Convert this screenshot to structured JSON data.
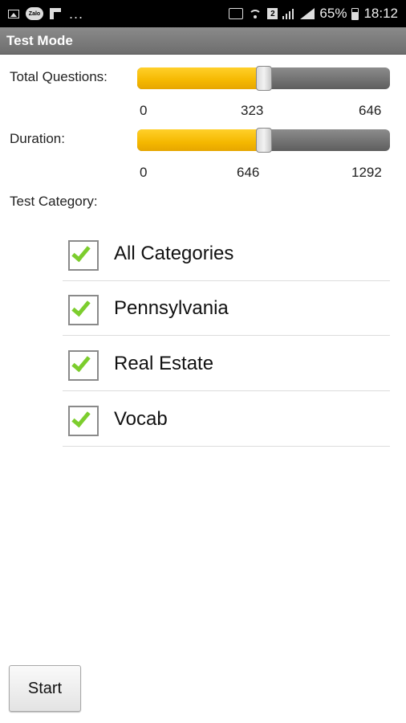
{
  "status_bar": {
    "left_icons": [
      "gallery-icon",
      "zalo-icon",
      "flipboard-icon"
    ],
    "overflow": "...",
    "battery": "65%",
    "time": "18:12",
    "right_icons": [
      "cast-icon",
      "wifi-icon",
      "sim2-icon",
      "signal-icon",
      "signal-full-icon",
      "battery-icon"
    ]
  },
  "title_bar": {
    "title": "Test Mode"
  },
  "total_questions": {
    "label": "Total Questions:",
    "min": "0",
    "mid": "323",
    "max": "646",
    "value": 323,
    "range": [
      0,
      646
    ],
    "fill_color": "#f5b800"
  },
  "duration": {
    "label": "Duration:",
    "min": "0",
    "mid": "646",
    "max": "1292",
    "value": 646,
    "range": [
      0,
      1292
    ],
    "fill_color": "#f5b800"
  },
  "category": {
    "label": "Test Category:",
    "items": [
      {
        "label": "All Categories",
        "checked": true
      },
      {
        "label": "Pennsylvania",
        "checked": true
      },
      {
        "label": "Real Estate",
        "checked": true
      },
      {
        "label": "Vocab",
        "checked": true
      }
    ],
    "check_color": "#7ccd2d"
  },
  "start_button": {
    "label": "Start"
  }
}
